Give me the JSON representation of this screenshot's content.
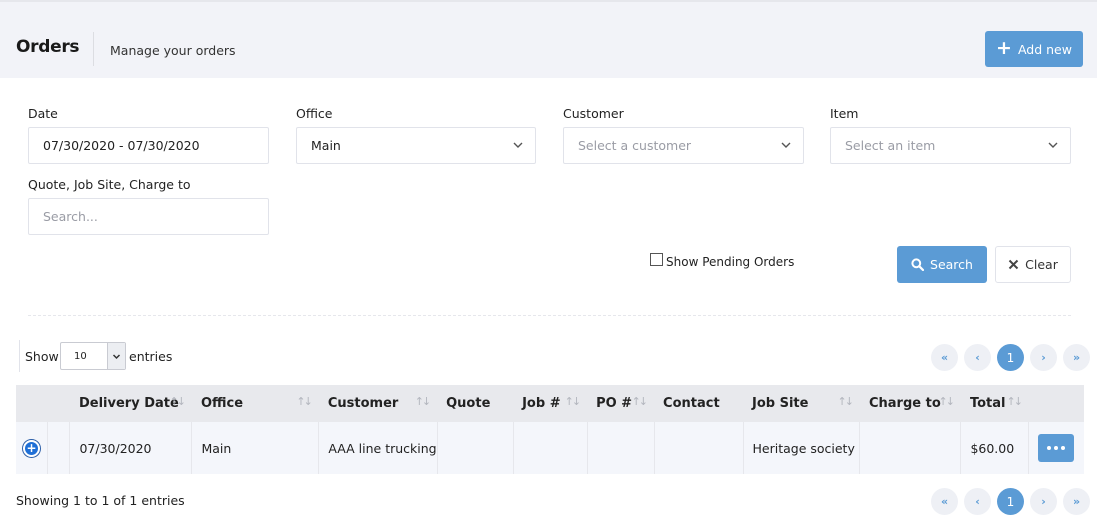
{
  "header": {
    "title": "Orders",
    "subtitle": "Manage your orders",
    "add_label": "Add new"
  },
  "filters": {
    "date": {
      "label": "Date",
      "value": "07/30/2020 - 07/30/2020"
    },
    "office": {
      "label": "Office",
      "value": "Main"
    },
    "customer": {
      "label": "Customer",
      "placeholder": "Select a customer"
    },
    "item": {
      "label": "Item",
      "placeholder": "Select an item"
    },
    "query": {
      "label": "Quote, Job Site, Charge to",
      "placeholder": "Search..."
    },
    "pending": {
      "label": "Show Pending Orders",
      "checked": false
    },
    "search_label": "Search",
    "clear_label": "Clear"
  },
  "length": {
    "show": "Show",
    "value": "10",
    "entries": "entries"
  },
  "pagination": {
    "first": "«",
    "prev": "‹",
    "page": "1",
    "next": "›",
    "last": "»"
  },
  "table": {
    "columns": [
      "Delivery Date",
      "Office",
      "Customer",
      "Quote",
      "Job #",
      "PO #",
      "Contact",
      "Job Site",
      "Charge to",
      "Total"
    ],
    "rows": [
      {
        "delivery_date": "07/30/2020",
        "office": "Main",
        "customer": "AAA line trucking",
        "quote": "",
        "job": "",
        "po": "",
        "contact": "",
        "job_site": "Heritage society",
        "charge_to": "",
        "total": "$60.00"
      }
    ]
  },
  "info": "Showing 1 to 1 of 1 entries",
  "colors": {
    "accent": "#5b9bd5",
    "header_bg": "#f2f3f8",
    "table_head": "#e8e9ed",
    "row_bg": "#f4f6fb"
  }
}
